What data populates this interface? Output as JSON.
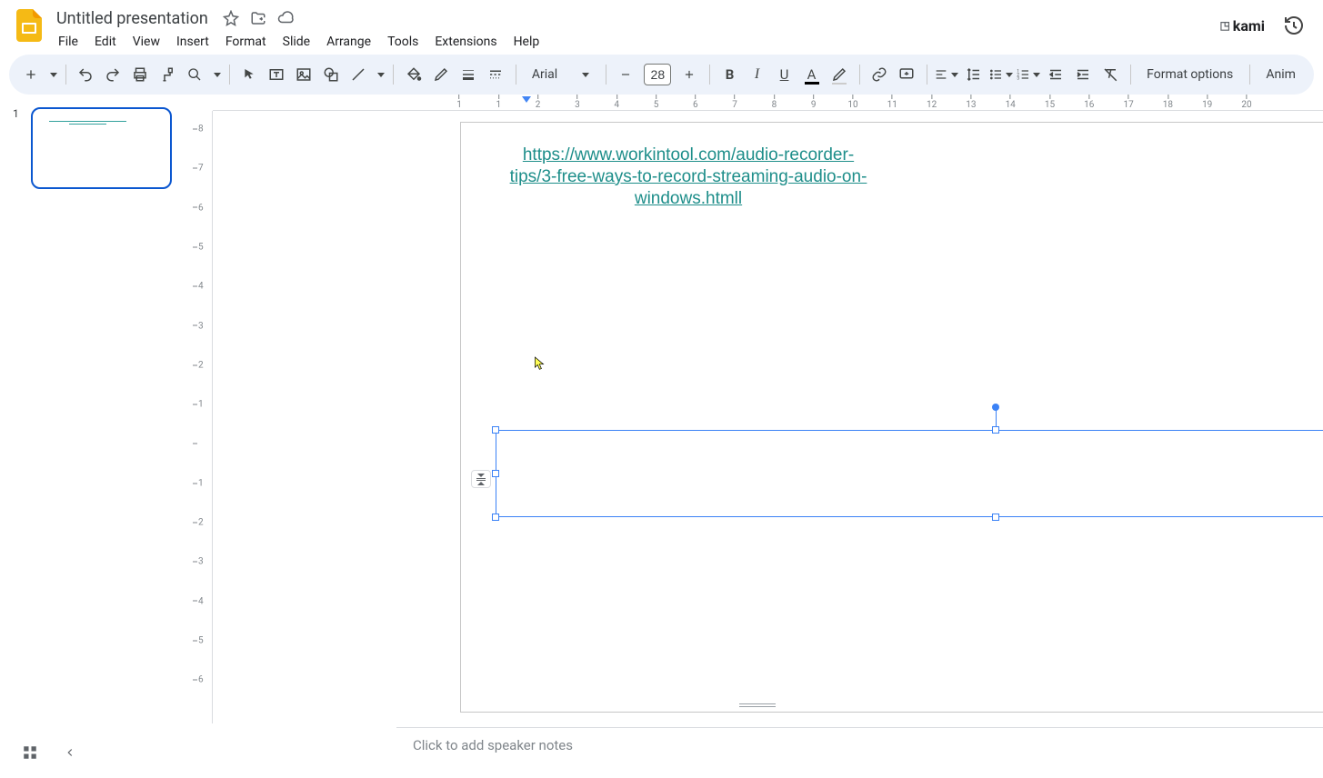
{
  "doc_title": "Untitled presentation",
  "menus": [
    "File",
    "Edit",
    "View",
    "Insert",
    "Format",
    "Slide",
    "Arrange",
    "Tools",
    "Extensions",
    "Help"
  ],
  "kami_label": "kami",
  "toolbar": {
    "font_name": "Arial",
    "font_size": "28",
    "format_options": "Format options",
    "anim": "Anim"
  },
  "slide_number": "1",
  "slide": {
    "link_text": "https://www.workintool.com/audio-recorder-tips/3-free-ways-to-record-streaming-audio-on-windows.htmll"
  },
  "notes_placeholder": "Click to add speaker notes",
  "ruler_h": [
    "1",
    "1",
    "2",
    "3",
    "4",
    "5",
    "6",
    "7",
    "8",
    "9",
    "10",
    "11",
    "12",
    "13",
    "14",
    "15",
    "16",
    "17",
    "18",
    "19",
    "20"
  ],
  "ruler_v": [
    "8",
    "7",
    "6",
    "5",
    "4",
    "3",
    "2",
    "1",
    "",
    "1",
    "2",
    "3",
    "4",
    "5",
    "6"
  ]
}
